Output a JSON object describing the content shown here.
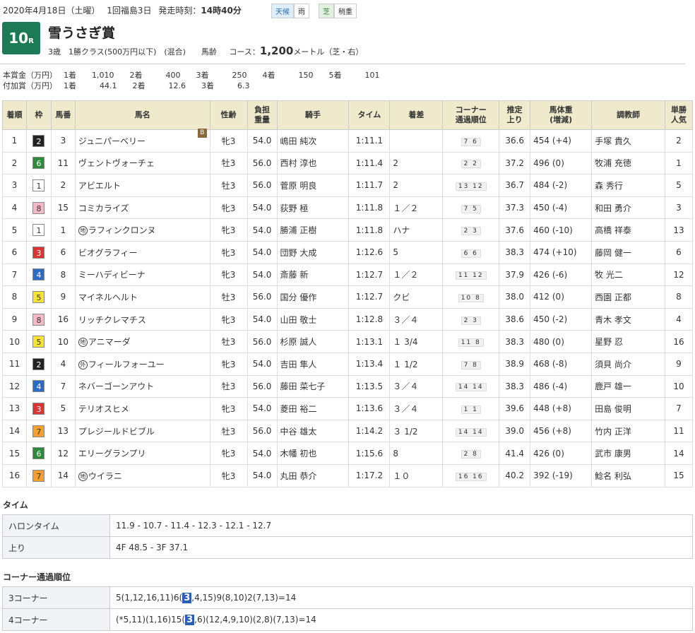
{
  "header": {
    "date": "2020年4月18日（土曜）",
    "meeting": "1回福島3日",
    "post_label": "発走時刻：",
    "post_time": "14時40分",
    "weather_label": "天候",
    "weather": "雨",
    "track_label": "芝",
    "track_cond": "稍重"
  },
  "race": {
    "num": "10",
    "r": "R",
    "name": "雪うさぎ賞",
    "conditions": "3歳　1勝クラス(500万円以下)　(混合)　　馬齢",
    "course_label": "コース：",
    "distance": "1,200",
    "course_tail": "メートル（芝・右）"
  },
  "prize": {
    "row1": "本賞金（万円）　 1着　　1,010　　2着　　　400　　3着　　　250　　4着　　　150　　5着　　　101",
    "row2": "付加賞（万円）　 1着　　　44.1　　2着　　　12.6　　3着　　　6.3"
  },
  "table": {
    "headers": [
      "着順",
      "枠",
      "馬番",
      "馬名",
      "性齢",
      "負担\n重量",
      "騎手",
      "タイム",
      "着差",
      "コーナー\n通過順位",
      "推定\n上り",
      "馬体重\n(増減)",
      "調教師",
      "単勝\n人気"
    ],
    "rows": [
      {
        "pos": "1",
        "waku": "2",
        "num": "3",
        "mark": "",
        "name": "ジュニパーベリー",
        "blink": "B",
        "sex": "牝3",
        "wt": "54.0",
        "jockey": "嶋田 純次",
        "time": "1:11.1",
        "margin": "",
        "corner": "7 6",
        "last": "36.6",
        "bw": "454 (+4)",
        "trainer": "手塚 貴久",
        "pop": "2"
      },
      {
        "pos": "2",
        "waku": "6",
        "num": "11",
        "mark": "",
        "name": "ヴェントヴォーチェ",
        "blink": "",
        "sex": "牡3",
        "wt": "56.0",
        "jockey": "西村 淳也",
        "time": "1:11.4",
        "margin": "2",
        "corner": "2 2",
        "last": "37.2",
        "bw": "496 (0)",
        "trainer": "牧浦 充徳",
        "pop": "1"
      },
      {
        "pos": "3",
        "waku": "1",
        "num": "2",
        "mark": "",
        "name": "アビエルト",
        "blink": "",
        "sex": "牡3",
        "wt": "56.0",
        "jockey": "菅原 明良",
        "time": "1:11.7",
        "margin": "2",
        "corner": "13 12",
        "last": "36.7",
        "bw": "484 (-2)",
        "trainer": "森 秀行",
        "pop": "5"
      },
      {
        "pos": "4",
        "waku": "8",
        "num": "15",
        "mark": "",
        "name": "コミカライズ",
        "blink": "",
        "sex": "牝3",
        "wt": "54.0",
        "jockey": "荻野 極",
        "time": "1:11.8",
        "margin": "１／２",
        "corner": "7 5",
        "last": "37.3",
        "bw": "450 (-4)",
        "trainer": "和田 勇介",
        "pop": "3"
      },
      {
        "pos": "5",
        "waku": "1",
        "num": "1",
        "mark": "地",
        "name": "ラフィンクロンヌ",
        "blink": "",
        "sex": "牝3",
        "wt": "54.0",
        "jockey": "勝浦 正樹",
        "time": "1:11.8",
        "margin": "ハナ",
        "corner": "2 3",
        "last": "37.6",
        "bw": "460 (-10)",
        "trainer": "高橋 祥泰",
        "pop": "13"
      },
      {
        "pos": "6",
        "waku": "3",
        "num": "6",
        "mark": "",
        "name": "ビオグラフィー",
        "blink": "",
        "sex": "牝3",
        "wt": "54.0",
        "jockey": "団野 大成",
        "time": "1:12.6",
        "margin": "5",
        "corner": "6 6",
        "last": "38.3",
        "bw": "474 (+10)",
        "trainer": "藤岡 健一",
        "pop": "6"
      },
      {
        "pos": "7",
        "waku": "4",
        "num": "8",
        "mark": "",
        "name": "ミーハディビーナ",
        "blink": "",
        "sex": "牝3",
        "wt": "54.0",
        "jockey": "斎藤 新",
        "time": "1:12.7",
        "margin": "１／２",
        "corner": "11 12",
        "last": "37.9",
        "bw": "426 (-6)",
        "trainer": "牧 光二",
        "pop": "12"
      },
      {
        "pos": "8",
        "waku": "5",
        "num": "9",
        "mark": "",
        "name": "マイネルヘルト",
        "blink": "",
        "sex": "牡3",
        "wt": "56.0",
        "jockey": "国分 優作",
        "time": "1:12.7",
        "margin": "クビ",
        "corner": "10 8",
        "last": "38.0",
        "bw": "412 (0)",
        "trainer": "西園 正都",
        "pop": "8"
      },
      {
        "pos": "9",
        "waku": "8",
        "num": "16",
        "mark": "",
        "name": "リッチクレマチス",
        "blink": "",
        "sex": "牝3",
        "wt": "54.0",
        "jockey": "山田 敬士",
        "time": "1:12.8",
        "margin": "３／４",
        "corner": "2 3",
        "last": "38.6",
        "bw": "450 (-2)",
        "trainer": "青木 孝文",
        "pop": "4"
      },
      {
        "pos": "10",
        "waku": "5",
        "num": "10",
        "mark": "地",
        "name": "アニマーダ",
        "blink": "",
        "sex": "牡3",
        "wt": "56.0",
        "jockey": "杉原 誠人",
        "time": "1:13.1",
        "margin": "１ 3/4",
        "corner": "11 8",
        "last": "38.3",
        "bw": "480 (0)",
        "trainer": "星野 忍",
        "pop": "16"
      },
      {
        "pos": "11",
        "waku": "2",
        "num": "4",
        "mark": "外",
        "name": "フィールフォーユー",
        "blink": "",
        "sex": "牝3",
        "wt": "54.0",
        "jockey": "吉田 隼人",
        "time": "1:13.4",
        "margin": "１ 1/2",
        "corner": "7 8",
        "last": "38.9",
        "bw": "468 (-8)",
        "trainer": "須貝 尚介",
        "pop": "9"
      },
      {
        "pos": "12",
        "waku": "4",
        "num": "7",
        "mark": "",
        "name": "ネバーゴーンアウト",
        "blink": "",
        "sex": "牡3",
        "wt": "56.0",
        "jockey": "藤田 菜七子",
        "time": "1:13.5",
        "margin": "３／４",
        "corner": "14 14",
        "last": "38.3",
        "bw": "486 (-4)",
        "trainer": "鹿戸 雄一",
        "pop": "10"
      },
      {
        "pos": "13",
        "waku": "3",
        "num": "5",
        "mark": "",
        "name": "テリオスヒメ",
        "blink": "",
        "sex": "牝3",
        "wt": "54.0",
        "jockey": "菱田 裕二",
        "time": "1:13.6",
        "margin": "３／４",
        "corner": "1 1",
        "last": "39.6",
        "bw": "448 (+8)",
        "trainer": "田島 俊明",
        "pop": "7"
      },
      {
        "pos": "14",
        "waku": "7",
        "num": "13",
        "mark": "",
        "name": "プレジールドビブル",
        "blink": "",
        "sex": "牡3",
        "wt": "56.0",
        "jockey": "中谷 雄太",
        "time": "1:14.2",
        "margin": "３ 1/2",
        "corner": "14 14",
        "last": "39.0",
        "bw": "456 (+8)",
        "trainer": "竹内 正洋",
        "pop": "11"
      },
      {
        "pos": "15",
        "waku": "6",
        "num": "12",
        "mark": "",
        "name": "エリーグランプリ",
        "blink": "",
        "sex": "牝3",
        "wt": "54.0",
        "jockey": "木幡 初也",
        "time": "1:15.6",
        "margin": "8",
        "corner": "2 8",
        "last": "41.4",
        "bw": "426 (0)",
        "trainer": "武市 康男",
        "pop": "14"
      },
      {
        "pos": "16",
        "waku": "7",
        "num": "14",
        "mark": "地",
        "name": "ウイラニ",
        "blink": "",
        "sex": "牝3",
        "wt": "54.0",
        "jockey": "丸田 恭介",
        "time": "1:17.2",
        "margin": "１０",
        "corner": "16 16",
        "last": "40.2",
        "bw": "392 (-19)",
        "trainer": "鯰名 利弘",
        "pop": "15"
      }
    ]
  },
  "time_section": {
    "title": "タイム",
    "furlong_label": "ハロンタイム",
    "furlong": "11.9 - 10.7 - 11.4 - 12.3 - 12.1 - 12.7",
    "agari_label": "上り",
    "agari": "4F 48.5 - 3F 37.1"
  },
  "corner_section": {
    "title": "コーナー通過順位",
    "c3_label": "3コーナー",
    "c3_a": "5(1,12,16,11)6(",
    "c3_hl": "3",
    "c3_b": ",4,15)9(8,10)2(7,13)=14",
    "c4_label": "4コーナー",
    "c4_a": "(*5,11)(1,16)15(",
    "c4_hl": "3",
    "c4_b": ",6)(12,4,9,10)(2,8)(7,13)=14"
  }
}
